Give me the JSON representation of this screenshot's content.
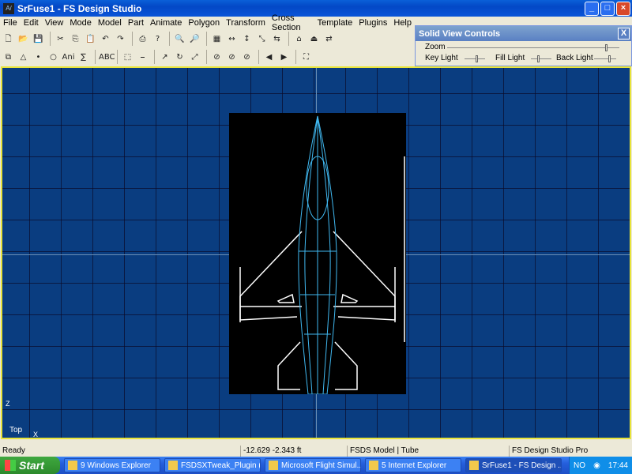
{
  "window": {
    "title": "SrFuse1 - FS Design Studio",
    "app_icon_text": "A/"
  },
  "menu": [
    "File",
    "Edit",
    "View",
    "Mode",
    "Model",
    "Part",
    "Animate",
    "Polygon",
    "Transform",
    "Cross Section",
    "Template",
    "Plugins",
    "Help"
  ],
  "toolbar1": [
    {
      "name": "new-icon",
      "glyph": "🗋"
    },
    {
      "name": "open-icon",
      "glyph": "📂"
    },
    {
      "name": "save-icon",
      "glyph": "💾"
    },
    {
      "name": "cut-icon",
      "glyph": "✂"
    },
    {
      "name": "copy-icon",
      "glyph": "⎘"
    },
    {
      "name": "paste-icon",
      "glyph": "📋"
    },
    {
      "name": "undo-icon",
      "glyph": "↶"
    },
    {
      "name": "redo-icon",
      "glyph": "↷"
    },
    {
      "name": "print-icon",
      "glyph": "⎙"
    },
    {
      "name": "help-icon",
      "glyph": "?"
    },
    {
      "name": "zoom-in-icon",
      "glyph": "🔍"
    },
    {
      "name": "zoom-out-icon",
      "glyph": "🔎"
    },
    {
      "name": "grid-icon",
      "glyph": "▦"
    },
    {
      "name": "scale-x-icon",
      "glyph": "↔"
    },
    {
      "name": "scale-y-icon",
      "glyph": "↕"
    },
    {
      "name": "scale-z-icon",
      "glyph": "⤡"
    },
    {
      "name": "align-icon",
      "glyph": "⇆"
    },
    {
      "name": "view-top-icon",
      "glyph": "⌂"
    },
    {
      "name": "view-side-icon",
      "glyph": "⏏"
    },
    {
      "name": "view-front-icon",
      "glyph": "⇄"
    }
  ],
  "toolbar2": [
    {
      "name": "part-icon",
      "glyph": "⧉"
    },
    {
      "name": "triangle-icon",
      "glyph": "△"
    },
    {
      "name": "point-icon",
      "glyph": "•"
    },
    {
      "name": "circle-icon",
      "glyph": "○"
    },
    {
      "name": "ani-icon",
      "glyph": "Ani"
    },
    {
      "name": "sum-icon",
      "glyph": "∑"
    },
    {
      "name": "text-icon",
      "glyph": "ABC"
    },
    {
      "name": "select-icon",
      "glyph": "⬚"
    },
    {
      "name": "line-icon",
      "glyph": "⎯"
    },
    {
      "name": "move-icon",
      "glyph": "↗"
    },
    {
      "name": "rotate-icon",
      "glyph": "↻"
    },
    {
      "name": "scale-icon",
      "glyph": "⤢"
    },
    {
      "name": "stop-1-icon",
      "glyph": "⊘"
    },
    {
      "name": "stop-2-icon",
      "glyph": "⊘"
    },
    {
      "name": "stop-3-icon",
      "glyph": "⊘"
    },
    {
      "name": "prev-icon",
      "glyph": "◀"
    },
    {
      "name": "next-icon",
      "glyph": "▶"
    },
    {
      "name": "binoculars-icon",
      "glyph": "⛶"
    }
  ],
  "solid_view": {
    "title": "Solid View Controls",
    "close_label": "X",
    "zoom_label": "Zoom",
    "key_light_label": "Key Light",
    "fill_light_label": "Fill Light",
    "back_light_label": "Back Light"
  },
  "viewport": {
    "view_label": "Top",
    "axis_z": "Z",
    "axis_x": "X",
    "background_color": "#0a3d80",
    "model_color": "#40b8f0"
  },
  "status": {
    "state": "Ready",
    "coords": "-12.629 -2.343 ft",
    "model": "FSDS Model | Tube",
    "app": "FS Design Studio Pro"
  },
  "taskbar": {
    "start_label": "Start",
    "tasks": [
      {
        "label": "9 Windows Explorer",
        "active": false
      },
      {
        "label": "FSDSXTweak_Plugin (...",
        "active": false
      },
      {
        "label": "Microsoft Flight Simul...",
        "active": false
      },
      {
        "label": "5 Internet Explorer",
        "active": false
      },
      {
        "label": "SrFuse1 - FS Design ...",
        "active": true
      }
    ],
    "lang": "NO",
    "time": "17:44"
  }
}
